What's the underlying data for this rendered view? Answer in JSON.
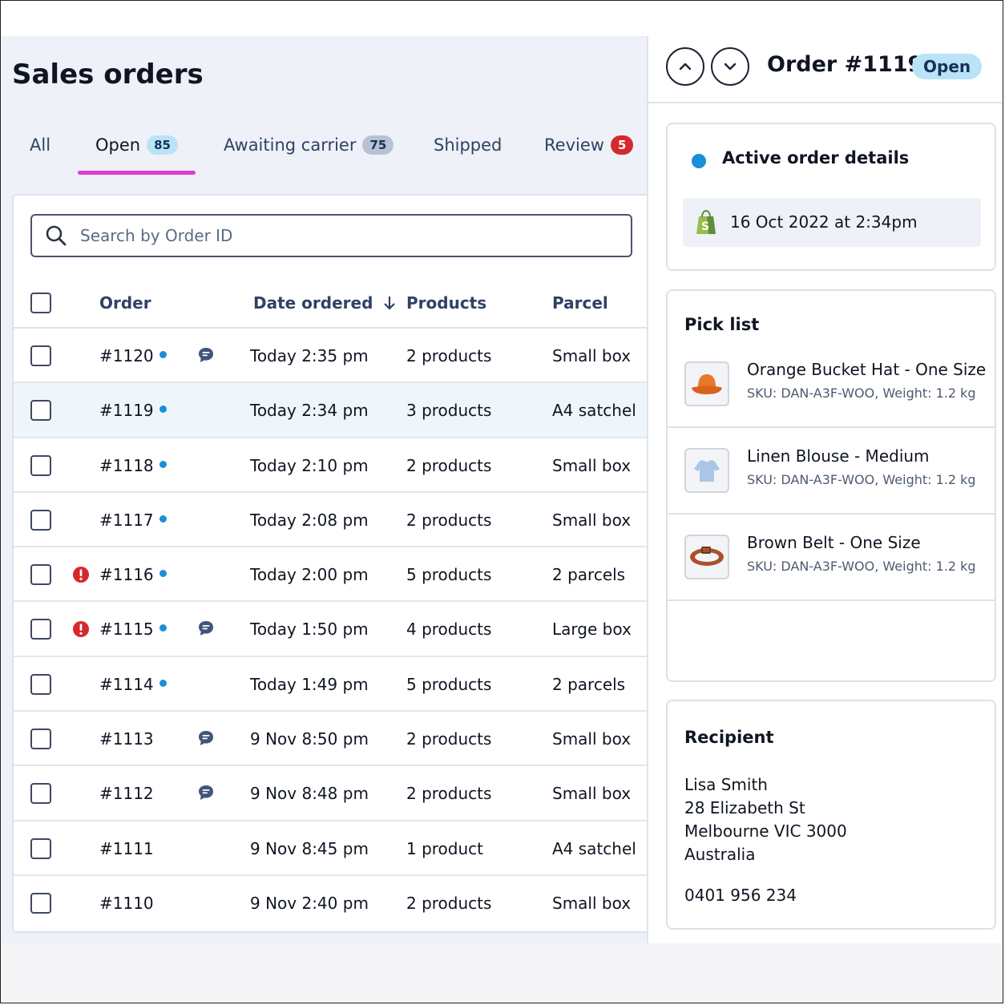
{
  "page_title": "Sales orders",
  "tabs": [
    {
      "label": "All",
      "badge": ""
    },
    {
      "label": "Open",
      "badge": "85"
    },
    {
      "label": "Awaiting carrier",
      "badge": "75"
    },
    {
      "label": "Shipped",
      "badge": ""
    },
    {
      "label": "Review",
      "badge": "5"
    }
  ],
  "active_tab": "Open",
  "search": {
    "placeholder": "Search by Order ID",
    "value": ""
  },
  "table": {
    "columns": [
      "Order",
      "Date ordered",
      "Products",
      "Parcel"
    ],
    "sort_column": "Date ordered",
    "sort_direction": "descending",
    "rows": [
      {
        "order": "#1120",
        "date": "Today 2:35 pm",
        "products": "2 products",
        "parcel": "Small box"
      },
      {
        "order": "#1119",
        "date": "Today 2:34 pm",
        "products": "3 products",
        "parcel": "A4 satchel"
      },
      {
        "order": "#1118",
        "date": "Today 2:10 pm",
        "products": "2 products",
        "parcel": "Small box"
      },
      {
        "order": "#1117",
        "date": "Today 2:08 pm",
        "products": "2 products",
        "parcel": "Small box"
      },
      {
        "order": "#1116",
        "date": "Today 2:00 pm",
        "products": "5 products",
        "parcel": "2 parcels"
      },
      {
        "order": "#1115",
        "date": "Today 1:50 pm",
        "products": "4 products",
        "parcel": "Large box"
      },
      {
        "order": "#1114",
        "date": "Today 1:49 pm",
        "products": "5 products",
        "parcel": "2 parcels"
      },
      {
        "order": "#1113",
        "date": "9 Nov 8:50 pm",
        "products": "2 products",
        "parcel": "Small box"
      },
      {
        "order": "#1112",
        "date": "9 Nov 8:48 pm",
        "products": "2 products",
        "parcel": "Small box"
      },
      {
        "order": "#1111",
        "date": "9 Nov 8:45 pm",
        "products": "1 product",
        "parcel": "A4 satchel"
      },
      {
        "order": "#1110",
        "date": "9 Nov 2:40 pm",
        "products": "2 products",
        "parcel": "Small box"
      }
    ]
  },
  "detail": {
    "order_title": "Order #1119",
    "status": "Open",
    "active_card": {
      "title": "Active order details",
      "date": "16 Oct 2022 at 2:34pm"
    },
    "pick_list": {
      "title": "Pick list",
      "items": [
        {
          "name": "Orange Bucket Hat - One Size",
          "sku": "SKU: DAN-A3F-WOO, Weight: 1.2 kg"
        },
        {
          "name": "Linen Blouse - Medium",
          "sku": "SKU: DAN-A3F-WOO, Weight: 1.2 kg"
        },
        {
          "name": "Brown Belt - One Size",
          "sku": "SKU: DAN-A3F-WOO, Weight: 1.2 kg"
        }
      ]
    },
    "recipient": {
      "title": "Recipient",
      "name": "Lisa Smith",
      "street": "28 Elizabeth St",
      "city": "Melbourne VIC 3000",
      "country": "Australia",
      "phone": "0401 956 234"
    }
  },
  "colors": {
    "accent_tab_underline": "#e03bd2",
    "new_dot": "#1a8fd6",
    "alert_red": "#d5292e",
    "badge_blue": "#b9e3f6"
  }
}
